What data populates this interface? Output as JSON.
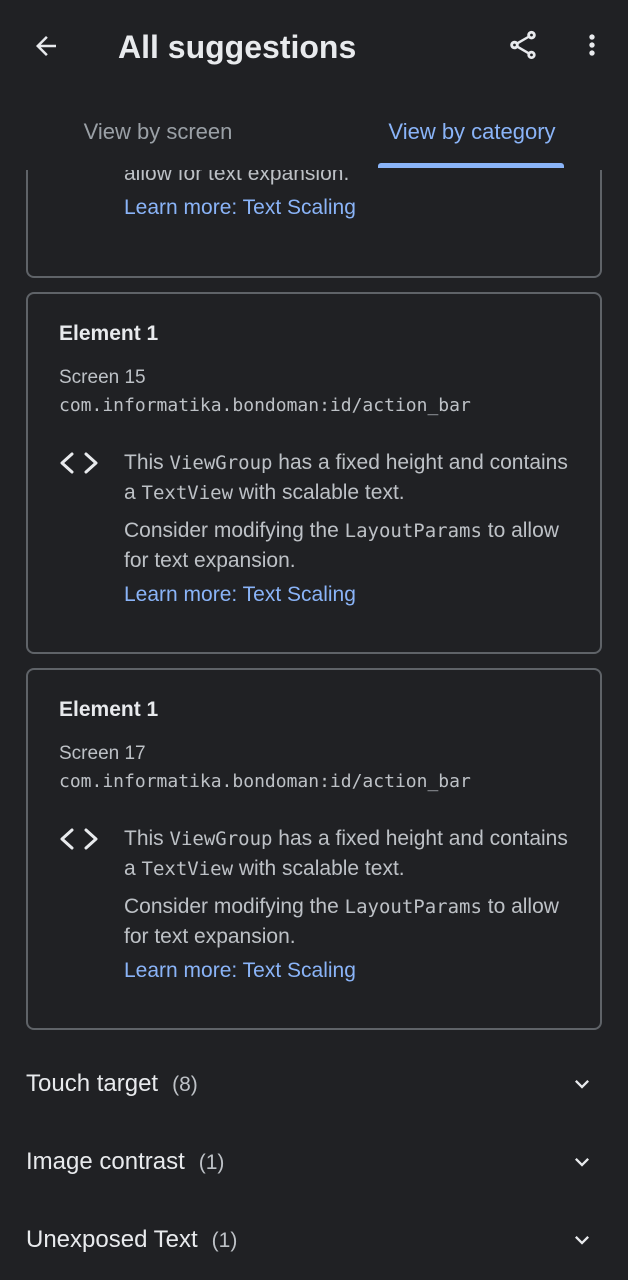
{
  "appbar": {
    "title": "All suggestions",
    "back_icon": "arrow-back-icon",
    "share_icon": "share-icon",
    "more_icon": "more-vert-icon"
  },
  "tabs": [
    {
      "label": "View by screen",
      "selected": false
    },
    {
      "label": "View by category",
      "selected": true
    }
  ],
  "partial_card": {
    "message_tail": "allow for text expansion.",
    "link": "Learn more: Text Scaling"
  },
  "cards": [
    {
      "title": "Element 1",
      "screen": "Screen 15",
      "resource_id": "com.informatika.bondoman:id/action_bar",
      "msg1_a": "This ",
      "msg1_code1": "ViewGroup",
      "msg1_b": " has a fixed height and contains a ",
      "msg1_code2": "TextView",
      "msg1_c": " with scalable text.",
      "msg2_a": "Consider modifying the ",
      "msg2_code": "LayoutParams",
      "msg2_b": " to allow for text expansion.",
      "link": "Learn more: Text Scaling"
    },
    {
      "title": "Element 1",
      "screen": "Screen 17",
      "resource_id": "com.informatika.bondoman:id/action_bar",
      "msg1_a": "This ",
      "msg1_code1": "ViewGroup",
      "msg1_b": " has a fixed height and contains a ",
      "msg1_code2": "TextView",
      "msg1_c": " with scalable text.",
      "msg2_a": "Consider modifying the ",
      "msg2_code": "LayoutParams",
      "msg2_b": " to allow for text expansion.",
      "link": "Learn more: Text Scaling"
    }
  ],
  "categories": [
    {
      "name": "Touch target",
      "count": "(8)"
    },
    {
      "name": "Image contrast",
      "count": "(1)"
    },
    {
      "name": "Unexposed Text",
      "count": "(1)"
    }
  ],
  "colors": {
    "background": "#202124",
    "accent": "#8ab4f8",
    "card_border": "#5f6368"
  }
}
